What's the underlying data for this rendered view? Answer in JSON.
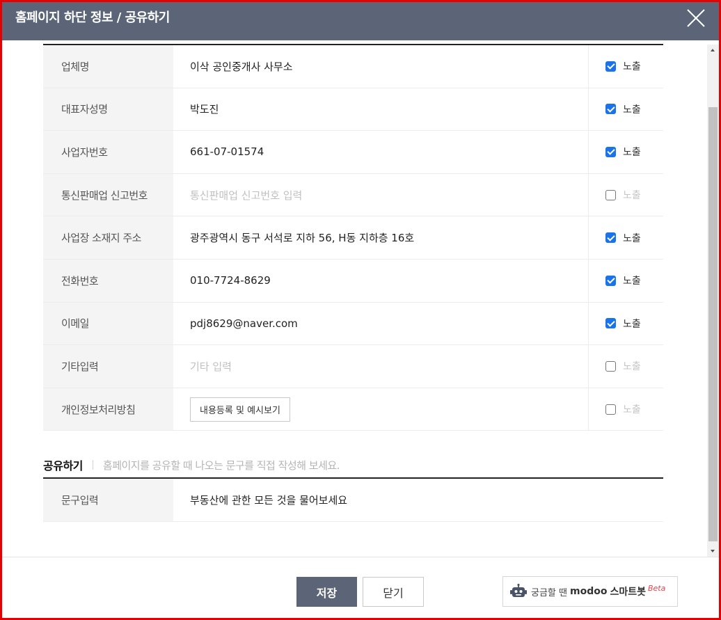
{
  "window": {
    "title": "홈페이지 하단 정보 / 공유하기"
  },
  "info_rows": [
    {
      "label": "업체명",
      "value": "이삭 공인중개사 사무소",
      "placeholder": false,
      "expose_label": "노출",
      "checked": true
    },
    {
      "label": "대표자성명",
      "value": "박도진",
      "placeholder": false,
      "expose_label": "노출",
      "checked": true
    },
    {
      "label": "사업자번호",
      "value": "661-07-01574",
      "placeholder": false,
      "expose_label": "노출",
      "checked": true
    },
    {
      "label": "통신판매업 신고번호",
      "value": "통신판매업 신고번호 입력",
      "placeholder": true,
      "expose_label": "노출",
      "checked": false
    },
    {
      "label": "사업장 소재지 주소",
      "value": "광주광역시 동구 서석로 지하 56, H동 지하층 16호",
      "placeholder": false,
      "expose_label": "노출",
      "checked": true
    },
    {
      "label": "전화번호",
      "value": "010-7724-8629",
      "placeholder": false,
      "expose_label": "노출",
      "checked": true
    },
    {
      "label": "이메일",
      "value": "pdj8629@naver.com",
      "placeholder": false,
      "expose_label": "노출",
      "checked": true
    },
    {
      "label": "기타입력",
      "value": "기타 입력",
      "placeholder": true,
      "expose_label": "노출",
      "checked": false
    }
  ],
  "privacy_row": {
    "label": "개인정보처리방침",
    "button_label": "내용등록 및 예시보기",
    "expose_label": "노출",
    "checked": false
  },
  "share": {
    "title": "공유하기",
    "description": "홈페이지를 공유할 때 나오는 문구를 직접 작성해 보세요.",
    "row_label": "문구입력",
    "row_value": "부동산에 관한 모든 것을 물어보세요"
  },
  "footer": {
    "save_label": "저장",
    "close_label": "닫기",
    "bot_prefix": "궁금할 땐",
    "bot_brand": "modoo",
    "bot_name": "스마트봇",
    "bot_beta": "Beta"
  },
  "colors": {
    "header_bg": "#5b6577",
    "checkbox_checked": "#1a73e8",
    "frame_border": "#e60000",
    "beta_text": "#e8404a"
  },
  "icons": {
    "close": "close-icon",
    "bot": "robot-icon"
  }
}
